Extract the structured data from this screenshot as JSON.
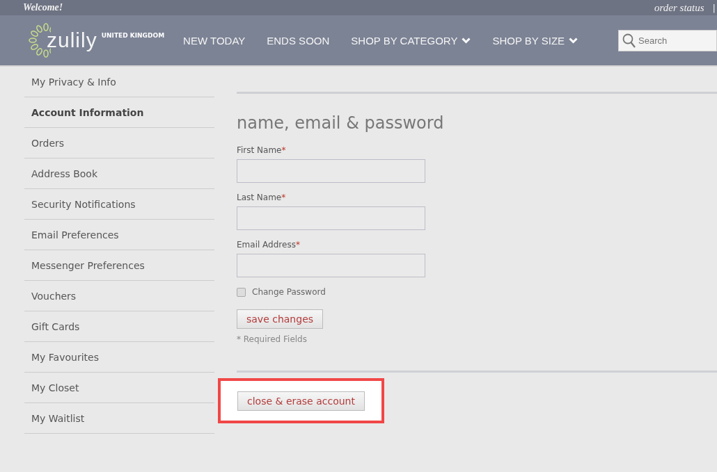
{
  "top_bar": {
    "welcome": "Welcome!",
    "order_status": "order status",
    "separator": "|"
  },
  "header": {
    "logo": "zulily",
    "region": "UNITED KINGDOM",
    "nav": [
      {
        "label": "NEW TODAY",
        "dropdown": false
      },
      {
        "label": "ENDS SOON",
        "dropdown": false
      },
      {
        "label": "SHOP BY CATEGORY",
        "dropdown": true
      },
      {
        "label": "SHOP BY SIZE",
        "dropdown": true
      }
    ],
    "search": {
      "placeholder": "Search"
    }
  },
  "sidebar": {
    "items": [
      {
        "label": "My Privacy & Info",
        "selected": false
      },
      {
        "label": "Account Information",
        "selected": true
      },
      {
        "label": "Orders",
        "selected": false
      },
      {
        "label": "Address Book",
        "selected": false
      },
      {
        "label": "Security Notifications",
        "selected": false
      },
      {
        "label": "Email Preferences",
        "selected": false
      },
      {
        "label": "Messenger Preferences",
        "selected": false
      },
      {
        "label": "Vouchers",
        "selected": false
      },
      {
        "label": "Gift Cards",
        "selected": false
      },
      {
        "label": "My Favourites",
        "selected": false
      },
      {
        "label": "My Closet",
        "selected": false
      },
      {
        "label": "My Waitlist",
        "selected": false
      }
    ]
  },
  "form": {
    "heading": "name, email & password",
    "fields": [
      {
        "label": "First Name",
        "required_mark": "*"
      },
      {
        "label": "Last Name",
        "required_mark": "*"
      },
      {
        "label": "Email Address",
        "required_mark": "*"
      }
    ],
    "change_password": {
      "label": "Change Password",
      "checked": false
    },
    "save_button": "save changes",
    "required_note": "* Required Fields"
  },
  "close_account": {
    "button": "close & erase account",
    "highlighted": true
  }
}
